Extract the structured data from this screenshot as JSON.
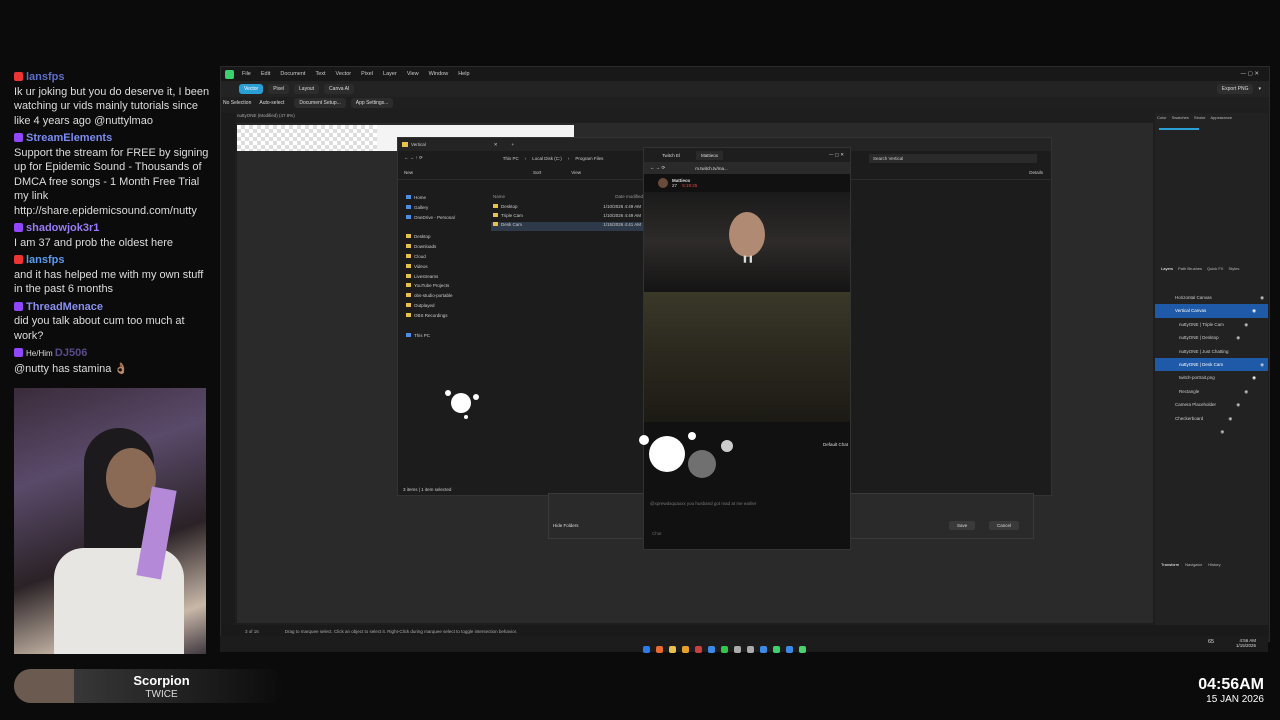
{
  "chat": [
    {
      "user": "lansfps",
      "text": "Ik ur joking but you do deserve it, I been watching ur vids mainly tutorials since like 4 years ago @nuttylmao",
      "color": "#5b6ec8",
      "badge": "#e33"
    },
    {
      "user": "StreamElements",
      "text": "Support the stream for FREE by signing up for Epidemic Sound - Thousands of DMCA free songs - 1 Month Free Trial my link http://share.epidemicsound.com/nutty",
      "color": "#7b8cf0",
      "badge": "#9147ff"
    },
    {
      "user": "shadowjok3r1",
      "text": "I am 37 and prob the oldest here",
      "color": "#9a7cf8",
      "badge": "#9147ff"
    },
    {
      "user": "lansfps",
      "text": "and it has helped me with my own stuff in the past 6 months",
      "color": "#5b9cf0",
      "badge": "#e33"
    },
    {
      "user": "ThreadMenace",
      "text": "did you talk about cum too much at work?",
      "color": "#8a8ff0",
      "badge": "#9147ff"
    },
    {
      "user": "DJ506",
      "pronoun": "He/Him",
      "text": "@nutty has stamina 👌🏽",
      "color": "#5a4a8a",
      "badge": "#9147ff"
    }
  ],
  "now_playing": {
    "title": "Scorpion",
    "artist": "TWICE"
  },
  "clock": {
    "time": "04:56AM",
    "date": "15 JAN 2026"
  },
  "app": {
    "menu": [
      "File",
      "Edit",
      "Document",
      "Text",
      "Vector",
      "Pixel",
      "Layer",
      "View",
      "Window",
      "Help"
    ],
    "modes": [
      "Vector",
      "Pixel",
      "Layout",
      "Canva AI"
    ],
    "selection": "No Selection",
    "auto_select": "Auto-select",
    "doc_setup": "Document Setup...",
    "app_settings": "App Settings...",
    "tab": "nuttyONE (Modified) (47.8%)",
    "export": "Export PNG",
    "status_hint": "Drag to marquee select. Click an object to select it. Right-Click during marquee select to toggle intersection behavior.",
    "page_indicator": "3 of 16",
    "layers": [
      "Horizontal Canvas",
      "Vertical Canvas",
      "nuttyONE | Triple Cam",
      "nuttyONE | Desktop",
      "nuttyONE | Just Chatting",
      "nuttyONE | Desk Cam",
      "twitch-portrait.png",
      "Rectangle",
      "Camera Placeholder",
      "Checkerboard"
    ],
    "panel_tabs": [
      "Color",
      "Swatches",
      "Stroke",
      "Appearance"
    ],
    "layer_tabs": [
      "Layers",
      "Path Brushes",
      "Quick FX",
      "Styles"
    ],
    "transform_tabs": [
      "Transform",
      "Navigator",
      "History"
    ]
  },
  "explorer": {
    "title": "Vertical",
    "path": [
      "This PC",
      "Local Disk (C:)",
      "Program Files"
    ],
    "search": "Search Vertical",
    "new": "New",
    "sort": "Sort",
    "view": "View",
    "details": "Details",
    "nav": [
      "Home",
      "Gallery",
      "OneDrive - Personal",
      "Desktop",
      "Downloads",
      "Cloud",
      "Videos",
      "Livestreams",
      "YouTube Projects",
      "obs-studio-portable",
      "Outplayed",
      "OBS Recordings",
      "This PC"
    ],
    "col_name": "Name",
    "col_date": "Date modified",
    "files": [
      {
        "name": "Desktop",
        "date": "1/10/2026 4:49 AM"
      },
      {
        "name": "Triple Cam",
        "date": "1/10/2026 4:49 AM"
      },
      {
        "name": "Desk Cam",
        "date": "1/15/2026 4:41 AM"
      }
    ],
    "status": "3 items  |  1 item selected",
    "hide": "Hide Folders",
    "save": "Save",
    "cancel": "Cancel"
  },
  "browser": {
    "tabs": [
      "Twitch El",
      "Mattieox"
    ],
    "url": "m.twitch.tv/ma...",
    "channel": "Mattieox",
    "viewers": "27",
    "uptime": "5:19:25",
    "chat_label": "Default Chat",
    "chat_placeholder": "Chat",
    "chat_line": "@xprewdxquaxxx you husband got mad at me earlier"
  },
  "taskbar": {
    "time": "4:56 AM",
    "date": "1/15/2026",
    "volume": "65"
  }
}
